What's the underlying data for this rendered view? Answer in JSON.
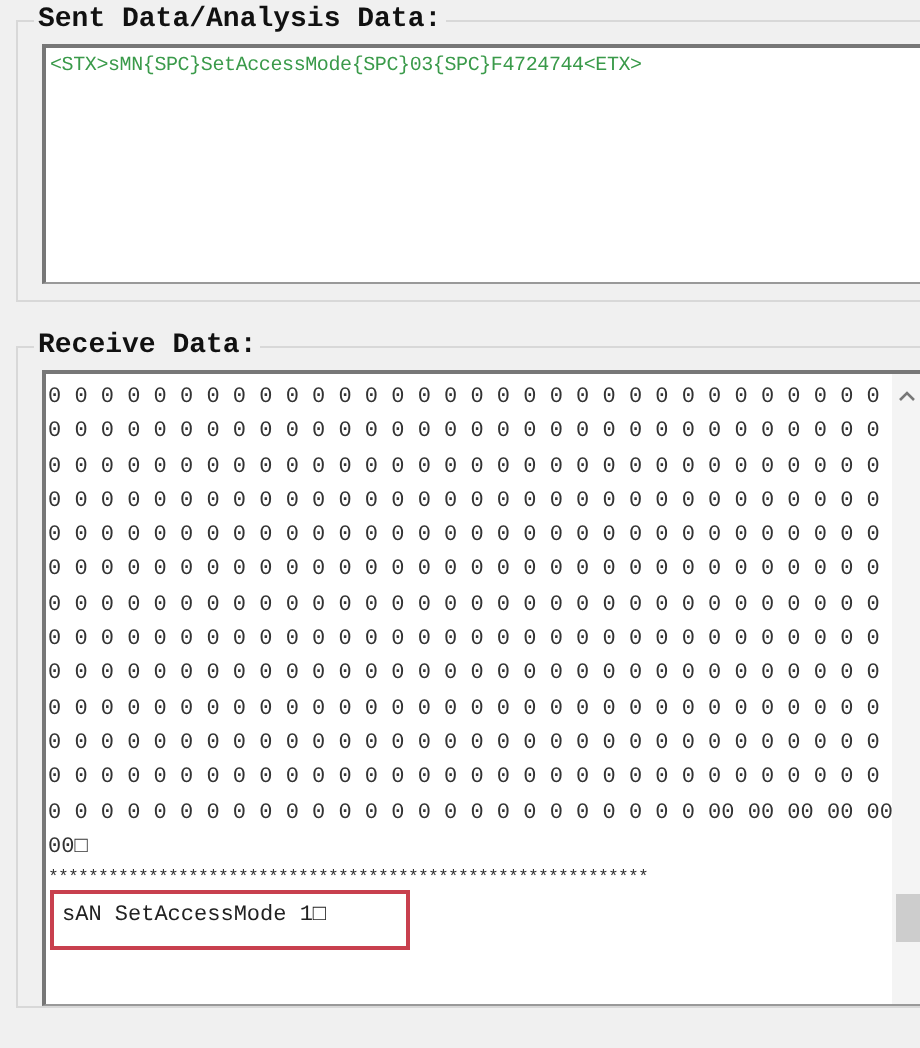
{
  "sent_group": {
    "title": "Sent Data/Analysis Data:",
    "text": "<STX>sMN{SPC}SetAccessMode{SPC}03{SPC}F4724744<ETX>"
  },
  "receive_group": {
    "title": "Receive Data:",
    "lines": [
      "0 0 0 0 0 0 0 0 0 0 0 0 0 0 0 0 0 0 0 0 0 0 0 0 0 0 0 0 0 0 0 0",
      "0 0 0 0 0 0 0 0 0 0 0 0 0 0 0 0 0 0 0 0 0 0 0 0 0 0 0 0 0 0 0 0",
      "0 0 0 0 0 0 0 0 0 0 0 0 0 0 0 0 0 0 0 0 0 0 0 0 0 0 0 0 0 0 0 0",
      "0 0 0 0 0 0 0 0 0 0 0 0 0 0 0 0 0 0 0 0 0 0 0 0 0 0 0 0 0 0 0 0",
      "0 0 0 0 0 0 0 0 0 0 0 0 0 0 0 0 0 0 0 0 0 0 0 0 0 0 0 0 0 0 0 0",
      "0 0 0 0 0 0 0 0 0 0 0 0 0 0 0 0 0 0 0 0 0 0 0 0 0 0 0 0 0 0 0 0",
      "0 0 0 0 0 0 0 0 0 0 0 0 0 0 0 0 0 0 0 0 0 0 0 0 0 0 0 0 0 0 0 0",
      "0 0 0 0 0 0 0 0 0 0 0 0 0 0 0 0 0 0 0 0 0 0 0 0 0 0 0 0 0 0 0 0",
      "0 0 0 0 0 0 0 0 0 0 0 0 0 0 0 0 0 0 0 0 0 0 0 0 0 0 0 0 0 0 0 0",
      "0 0 0 0 0 0 0 0 0 0 0 0 0 0 0 0 0 0 0 0 0 0 0 0 0 0 0 0 0 0 0 0",
      "0 0 0 0 0 0 0 0 0 0 0 0 0 0 0 0 0 0 0 0 0 0 0 0 0 0 0 0 0 0 0 0",
      "0 0 0 0 0 0 0 0 0 0 0 0 0 0 0 0 0 0 0 0 0 0 0 0 0 0 0 0 0 0 0 0",
      "0 0 0 0 0 0 0 0 0 0 0 0 0 0 0 0 0 0 0 0 0 0 0 0 0 00 00 00 00 00",
      "00□"
    ],
    "separator": "************************************************************",
    "response": {
      "text": "sAN SetAccessMode 1□",
      "highlighted": true
    }
  }
}
